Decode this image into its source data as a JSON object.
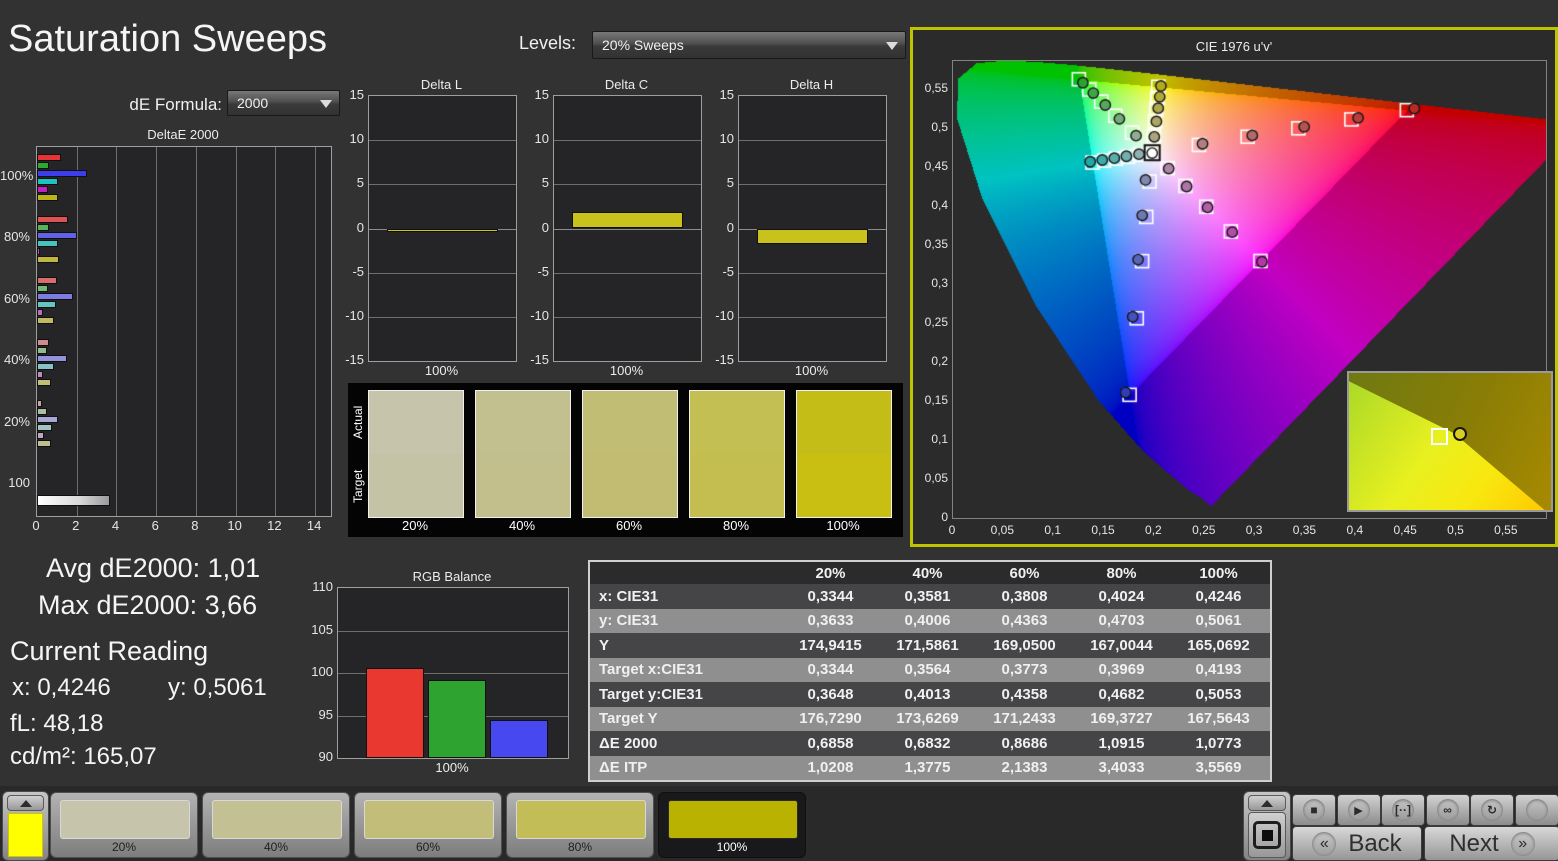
{
  "header": {
    "title": "Saturation Sweeps",
    "de_formula_label": "dE Formula:",
    "de_formula_value": "2000",
    "levels_label": "Levels:",
    "levels_value": "20% Sweeps"
  },
  "stats": {
    "avg": "Avg dE2000: 1,01",
    "max": "Max dE2000: 3,66",
    "current_reading_title": "Current Reading",
    "x": "x: 0,4246",
    "y": "y: 0,5061",
    "fl": "fL: 48,18",
    "cdm2": "cd/m²: 165,07"
  },
  "chart_data": {
    "deltae": {
      "type": "bar",
      "orientation": "horizontal",
      "title": "DeltaE 2000",
      "xlim": [
        0,
        14.8
      ],
      "xticks": [
        0,
        2,
        4,
        6,
        8,
        10,
        12,
        14
      ],
      "series_names": [
        "Red",
        "Green",
        "Blue",
        "Cyan",
        "Magenta",
        "Yellow"
      ],
      "groups": [
        {
          "label": "100%",
          "values": [
            1.2,
            0.6,
            2.5,
            1.05,
            0.55,
            1.08
          ],
          "colors": [
            "#e63434",
            "#2fa82f",
            "#3d3dec",
            "#1fc2c2",
            "#c021c0",
            "#bdb517"
          ]
        },
        {
          "label": "80%",
          "values": [
            1.55,
            0.6,
            2.0,
            1.05,
            0.15,
            1.09
          ],
          "colors": [
            "#dd5252",
            "#57b357",
            "#6161e6",
            "#46c2c0",
            "#bd4fbd",
            "#bdb63f"
          ]
        },
        {
          "label": "60%",
          "values": [
            1.0,
            0.55,
            1.8,
            0.95,
            0.3,
            0.87
          ],
          "colors": [
            "#d66e6e",
            "#74b974",
            "#7c7ce2",
            "#64c4c2",
            "#bd6cbd",
            "#c0ba5e"
          ]
        },
        {
          "label": "40%",
          "values": [
            0.6,
            0.5,
            1.5,
            0.85,
            0.3,
            0.69
          ],
          "colors": [
            "#cf8c8c",
            "#8fbd8f",
            "#9292dd",
            "#84c4c2",
            "#bd8abd",
            "#c2bd78"
          ]
        },
        {
          "label": "20%",
          "values": [
            0.25,
            0.5,
            1.05,
            0.75,
            0.35,
            0.69
          ],
          "colors": [
            "#c9a4a4",
            "#a9bfa0",
            "#a8a8d6",
            "#a0c4c2",
            "#bfa6bf",
            "#c2be90"
          ]
        },
        {
          "label": "100",
          "values": [
            3.66
          ],
          "colors": [
            "#ffffff"
          ]
        }
      ]
    },
    "delta_l": {
      "type": "bar",
      "title": "Delta L",
      "ylim": [
        -15,
        15
      ],
      "yticks": [
        15,
        10,
        5,
        0,
        -5,
        -10,
        -15
      ],
      "categories": [
        "100%"
      ],
      "xlabel": "100%",
      "values": [
        -0.2
      ],
      "color": "#c9c21d"
    },
    "delta_c": {
      "type": "bar",
      "title": "Delta C",
      "ylim": [
        -15,
        15
      ],
      "yticks": [
        15,
        10,
        5,
        0,
        -5,
        -10,
        -15
      ],
      "categories": [
        "100%"
      ],
      "xlabel": "100%",
      "values": [
        1.9
      ],
      "color": "#c9c21d"
    },
    "delta_h": {
      "type": "bar",
      "title": "Delta H",
      "ylim": [
        -15,
        15
      ],
      "yticks": [
        15,
        10,
        5,
        0,
        -5,
        -10,
        -15
      ],
      "categories": [
        "100%"
      ],
      "xlabel": "100%",
      "values": [
        -1.8
      ],
      "color": "#c9c21d"
    },
    "rgb_balance": {
      "type": "bar",
      "title": "RGB Balance",
      "ylim": [
        90,
        110
      ],
      "yticks": [
        110,
        105,
        100,
        95,
        90
      ],
      "categories": [
        "100%"
      ],
      "xlabel": "100%",
      "series": [
        {
          "name": "Red",
          "value": 100.6,
          "color": "#e83830"
        },
        {
          "name": "Green",
          "value": 99.2,
          "color": "#2fa32f"
        },
        {
          "name": "Blue",
          "value": 94.5,
          "color": "#4848f0"
        }
      ]
    },
    "cie": {
      "type": "scatter",
      "title": "CIE 1976 u'v'",
      "xlim": [
        0,
        0.589
      ],
      "ylim": [
        0,
        0.586
      ],
      "xticks": [
        0,
        0.05,
        0.1,
        0.15,
        0.2,
        0.25,
        0.3,
        0.35,
        0.4,
        0.45,
        0.5,
        0.55
      ],
      "yticks": [
        0,
        0.05,
        0.1,
        0.15,
        0.2,
        0.25,
        0.3,
        0.35,
        0.4,
        0.45,
        0.5,
        0.55
      ],
      "locus": [
        [
          0.2569,
          0.0172
        ],
        [
          0.2557,
          0.0159
        ],
        [
          0.2443,
          0.028
        ],
        [
          0.2347,
          0.035
        ],
        [
          0.2161,
          0.0549
        ],
        [
          0.1877,
          0.0871
        ],
        [
          0.1441,
          0.151
        ],
        [
          0.0828,
          0.2708
        ],
        [
          0.0282,
          0.4117
        ],
        [
          0.0035,
          0.5131
        ],
        [
          0.0046,
          0.5638
        ],
        [
          0.0231,
          0.5837
        ],
        [
          0.0501,
          0.5868
        ],
        [
          0.0792,
          0.5856
        ],
        [
          0.1127,
          0.5821
        ],
        [
          0.1531,
          0.5766
        ],
        [
          0.2026,
          0.5694
        ],
        [
          0.2623,
          0.5604
        ],
        [
          0.3315,
          0.5501
        ],
        [
          0.4035,
          0.5393
        ],
        [
          0.4692,
          0.5296
        ],
        [
          0.5203,
          0.5219
        ],
        [
          0.583,
          0.5125
        ],
        [
          0.6234,
          0.5065
        ]
      ],
      "rec709_triangle": [
        [
          0.4507,
          0.5229
        ],
        [
          0.125,
          0.5625
        ],
        [
          0.1754,
          0.1579
        ]
      ],
      "white_point": {
        "target": [
          0.1978,
          0.4683
        ],
        "measured": [
          0.1978,
          0.4678
        ]
      },
      "series": [
        {
          "name": "Green",
          "targets": [
            [
              0.1778,
              0.4942
            ],
            [
              0.1612,
              0.5157
            ],
            [
              0.1472,
              0.5338
            ],
            [
              0.1353,
              0.5492
            ],
            [
              0.125,
              0.5625
            ]
          ],
          "measured": [
            [
              0.1818,
              0.4902
            ],
            [
              0.1652,
              0.5117
            ],
            [
              0.1512,
              0.5295
            ],
            [
              0.1393,
              0.5448
            ],
            [
              0.129,
              0.558
            ]
          ],
          "colors": [
            "#8fae92",
            "#74ab77",
            "#58a75e",
            "#3ea546",
            "#27a32f"
          ]
        },
        {
          "name": "Yellow",
          "targets": [
            [
              0.1994,
              0.4894
            ],
            [
              0.2007,
              0.5085
            ],
            [
              0.2019,
              0.5247
            ],
            [
              0.2029,
              0.5385
            ],
            [
              0.2039,
              0.5529
            ]
          ],
          "measured": [
            [
              0.1999,
              0.4887
            ],
            [
              0.202,
              0.5084
            ],
            [
              0.2038,
              0.5254
            ],
            [
              0.2053,
              0.54
            ],
            [
              0.2065,
              0.5539
            ]
          ],
          "colors": [
            "#aaa47e",
            "#aca663",
            "#aea84c",
            "#b0a935",
            "#b3aa1e"
          ]
        },
        {
          "name": "Cyan",
          "targets": [
            [
              0.1857,
              0.4657
            ],
            [
              0.1737,
              0.4632
            ],
            [
              0.1619,
              0.4607
            ],
            [
              0.1501,
              0.4582
            ],
            [
              0.1385,
              0.4557
            ]
          ],
          "measured": [
            [
              0.1847,
              0.4665
            ],
            [
              0.1722,
              0.4638
            ],
            [
              0.1602,
              0.4613
            ],
            [
              0.1482,
              0.459
            ],
            [
              0.1362,
              0.4567
            ]
          ],
          "colors": [
            "#8fb2b0",
            "#73b0ad",
            "#58aeaa",
            "#3daba7",
            "#23a9a4"
          ]
        },
        {
          "name": "Red",
          "targets": [
            [
              0.2442,
              0.4783
            ],
            [
              0.2926,
              0.4888
            ],
            [
              0.343,
              0.4996
            ],
            [
              0.3956,
              0.511
            ],
            [
              0.4507,
              0.5229
            ]
          ],
          "measured": [
            [
              0.2478,
              0.4798
            ],
            [
              0.2972,
              0.4905
            ],
            [
              0.3487,
              0.5015
            ],
            [
              0.4023,
              0.5129
            ],
            [
              0.4581,
              0.525
            ]
          ],
          "colors": [
            "#b08080",
            "#b26a68",
            "#b45452",
            "#b63e3b",
            "#b92a24"
          ]
        },
        {
          "name": "Magenta",
          "targets": [
            [
              0.2132,
              0.4485
            ],
            [
              0.2308,
              0.4257
            ],
            [
              0.2515,
              0.399
            ],
            [
              0.2759,
              0.3674
            ],
            [
              0.3053,
              0.3295
            ]
          ],
          "measured": [
            [
              0.2142,
              0.448
            ],
            [
              0.232,
              0.425
            ],
            [
              0.2528,
              0.3982
            ],
            [
              0.2773,
              0.3665
            ],
            [
              0.3068,
              0.3285
            ]
          ],
          "colors": [
            "#ab86a6",
            "#ad74a7",
            "#b061a8",
            "#b24da9",
            "#b538a9"
          ]
        },
        {
          "name": "Blue",
          "targets": [
            [
              0.1952,
              0.4314
            ],
            [
              0.1919,
              0.386
            ],
            [
              0.1878,
              0.3293
            ],
            [
              0.1825,
              0.256
            ],
            [
              0.1754,
              0.1579
            ]
          ],
          "measured": [
            [
              0.1912,
              0.4334
            ],
            [
              0.1879,
              0.388
            ],
            [
              0.1838,
              0.3313
            ],
            [
              0.1785,
              0.258
            ],
            [
              0.1714,
              0.1609
            ]
          ],
          "colors": [
            "#8189b0",
            "#6c7ab2",
            "#5767b5",
            "#4252b8",
            "#2f3dbb"
          ]
        }
      ],
      "inset": {
        "square_pos": [
          0.44,
          0.45
        ],
        "circle_pos": [
          0.545,
          0.44
        ],
        "circle_color": "#d8ce1e"
      }
    }
  },
  "swatch_panel": {
    "row_labels": [
      "Actual",
      "Target"
    ],
    "items": [
      {
        "label": "20%",
        "actual": "#c6c5ab",
        "target": "#c4c3a6"
      },
      {
        "label": "40%",
        "actual": "#c3c08f",
        "target": "#c2bf8c"
      },
      {
        "label": "60%",
        "actual": "#c2bd75",
        "target": "#c1bc72"
      },
      {
        "label": "80%",
        "actual": "#c4bf52",
        "target": "#c3be4f"
      },
      {
        "label": "100%",
        "actual": "#c5bd17",
        "target": "#c9bf12"
      }
    ]
  },
  "table": {
    "headers": [
      "20%",
      "40%",
      "60%",
      "80%",
      "100%"
    ],
    "rows": [
      {
        "label": "x: CIE31",
        "values": [
          "0,3344",
          "0,3581",
          "0,3808",
          "0,4024",
          "0,4246"
        ]
      },
      {
        "label": "y: CIE31",
        "values": [
          "0,3633",
          "0,4006",
          "0,4363",
          "0,4703",
          "0,5061"
        ]
      },
      {
        "label": "Y",
        "values": [
          "174,9415",
          "171,5861",
          "169,0500",
          "167,0044",
          "165,0692"
        ]
      },
      {
        "label": "Target x:CIE31",
        "values": [
          "0,3344",
          "0,3564",
          "0,3773",
          "0,3969",
          "0,4193"
        ]
      },
      {
        "label": "Target y:CIE31",
        "values": [
          "0,3648",
          "0,4013",
          "0,4358",
          "0,4682",
          "0,5053"
        ]
      },
      {
        "label": "Target Y",
        "values": [
          "176,7290",
          "173,6269",
          "171,2433",
          "169,3727",
          "167,5643"
        ]
      },
      {
        "label": "ΔE 2000",
        "values": [
          "0,6858",
          "0,6832",
          "0,8686",
          "1,0915",
          "1,0773"
        ]
      },
      {
        "label": "ΔE ITP",
        "values": [
          "1,0208",
          "1,3775",
          "2,1383",
          "3,4033",
          "3,5569"
        ]
      }
    ]
  },
  "bottom": {
    "current_color": "#ffff00",
    "sweeps": [
      {
        "label": "20%",
        "color": "#c6c5ac",
        "selected": false
      },
      {
        "label": "40%",
        "color": "#c3c094",
        "selected": false
      },
      {
        "label": "60%",
        "color": "#c2be7a",
        "selected": false
      },
      {
        "label": "80%",
        "color": "#c2bd57",
        "selected": false
      },
      {
        "label": "100%",
        "color": "#b9b200",
        "selected": true
      }
    ],
    "transport": [
      {
        "name": "stop",
        "glyph": "■"
      },
      {
        "name": "play",
        "glyph": "▶"
      },
      {
        "name": "range",
        "glyph": "[··]"
      },
      {
        "name": "continuous",
        "glyph": "∞"
      },
      {
        "name": "loop",
        "glyph": "↻"
      },
      {
        "name": "blank",
        "glyph": ""
      }
    ],
    "back_label": "Back",
    "next_label": "Next",
    "back_chevron": "«",
    "next_chevron": "»"
  }
}
